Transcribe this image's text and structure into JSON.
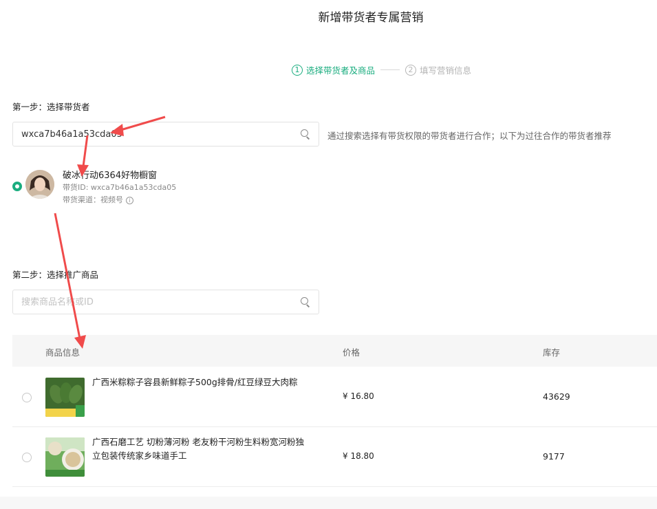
{
  "page": {
    "title": "新增带货者专属营销"
  },
  "steps": [
    {
      "num": "1",
      "label": "选择带货者及商品"
    },
    {
      "num": "2",
      "label": "填写营销信息"
    }
  ],
  "step1": {
    "label": "第一步：选择带货者",
    "search_value": "wxca7b46a1a53cda05",
    "hint": "通过搜索选择有带货权限的带货者进行合作；以下为过往合作的带货者推荐"
  },
  "creator": {
    "name": "破冰行动6364好物橱窗",
    "id_line": "带货ID: wxca7b46a1a53cda05",
    "channel_line": "带货渠道：视频号"
  },
  "step2": {
    "label": "第二步：选择推广商品",
    "search_placeholder": "搜索商品名称或ID"
  },
  "table": {
    "headers": {
      "info": "商品信息",
      "price": "价格",
      "stock": "库存"
    },
    "rows": [
      {
        "name": "广西米粽粽子容县新鲜粽子500g排骨/红豆绿豆大肉粽",
        "price": "¥ 16.80",
        "stock": "43629"
      },
      {
        "name": "广西石磨工艺 切粉薄河粉 老友粉干河粉生料粉宽河粉独立包装传统家乡味道手工",
        "price": "¥ 18.80",
        "stock": "9177"
      }
    ]
  },
  "colors": {
    "accent": "#1aad7f",
    "arrow": "#f04b4b"
  }
}
